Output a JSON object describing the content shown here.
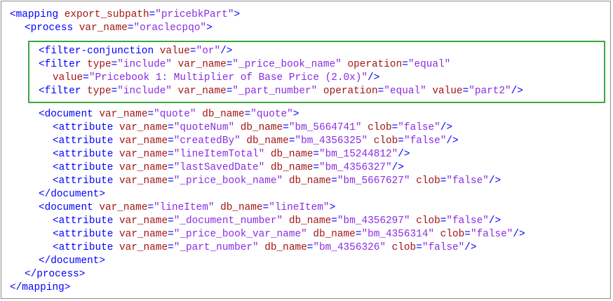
{
  "colors": {
    "tag": "#0000ff",
    "attr": "#a31515",
    "value": "#8a2be2",
    "highlight": "#3da63d"
  },
  "lines": [
    [
      [
        "tag",
        "<mapping"
      ],
      [
        "attr",
        " export_subpath"
      ],
      [
        "tag",
        "="
      ],
      [
        "val",
        "\"pricebkPart\""
      ],
      [
        "tag",
        ">"
      ]
    ],
    [
      [
        "tag",
        "<process"
      ],
      [
        "attr",
        " var_name"
      ],
      [
        "tag",
        "="
      ],
      [
        "val",
        "\"oraclecpqo\""
      ],
      [
        "tag",
        ">"
      ]
    ],
    [
      [
        "tag",
        "<filter-conjunction"
      ],
      [
        "attr",
        " value"
      ],
      [
        "tag",
        "="
      ],
      [
        "val",
        "\"or\""
      ],
      [
        "tag",
        "/>"
      ]
    ],
    [
      [
        "tag",
        "<filter"
      ],
      [
        "attr",
        " type"
      ],
      [
        "tag",
        "="
      ],
      [
        "val",
        "\"include\""
      ],
      [
        "attr",
        " var_name"
      ],
      [
        "tag",
        "="
      ],
      [
        "val",
        "\"_price_book_name\""
      ],
      [
        "attr",
        " operation"
      ],
      [
        "tag",
        "="
      ],
      [
        "val",
        "\"equal\""
      ]
    ],
    [
      [
        "attr",
        "value"
      ],
      [
        "tag",
        "="
      ],
      [
        "val",
        "\"Pricebook 1: Multiplier of Base Price (2.0x)\""
      ],
      [
        "tag",
        "/>"
      ]
    ],
    [
      [
        "tag",
        "<filter"
      ],
      [
        "attr",
        " type"
      ],
      [
        "tag",
        "="
      ],
      [
        "val",
        "\"include\""
      ],
      [
        "attr",
        " var_name"
      ],
      [
        "tag",
        "="
      ],
      [
        "val",
        "\"_part_number\""
      ],
      [
        "attr",
        " operation"
      ],
      [
        "tag",
        "="
      ],
      [
        "val",
        "\"equal\""
      ],
      [
        "attr",
        " value"
      ],
      [
        "tag",
        "="
      ],
      [
        "val",
        "\"part2\""
      ],
      [
        "tag",
        "/>"
      ]
    ],
    [
      [
        "tag",
        "<document"
      ],
      [
        "attr",
        " var_name"
      ],
      [
        "tag",
        "="
      ],
      [
        "val",
        "\"quote\""
      ],
      [
        "attr",
        " db_name"
      ],
      [
        "tag",
        "="
      ],
      [
        "val",
        "\"quote\""
      ],
      [
        "tag",
        ">"
      ]
    ],
    [
      [
        "tag",
        "<attribute"
      ],
      [
        "attr",
        " var_name"
      ],
      [
        "tag",
        "="
      ],
      [
        "val",
        "\"quoteNum\""
      ],
      [
        "attr",
        " db_name"
      ],
      [
        "tag",
        "="
      ],
      [
        "val",
        "\"bm_5664741\""
      ],
      [
        "attr",
        " clob"
      ],
      [
        "tag",
        "="
      ],
      [
        "val",
        "\"false\""
      ],
      [
        "tag",
        "/>"
      ]
    ],
    [
      [
        "tag",
        "<attribute"
      ],
      [
        "attr",
        " var_name"
      ],
      [
        "tag",
        "="
      ],
      [
        "val",
        "\"createdBy\""
      ],
      [
        "attr",
        " db_name"
      ],
      [
        "tag",
        "="
      ],
      [
        "val",
        "\"bm_4356325\""
      ],
      [
        "attr",
        " clob"
      ],
      [
        "tag",
        "="
      ],
      [
        "val",
        "\"false\""
      ],
      [
        "tag",
        "/>"
      ]
    ],
    [
      [
        "tag",
        "<attribute"
      ],
      [
        "attr",
        " var_name"
      ],
      [
        "tag",
        "="
      ],
      [
        "val",
        "\"lineItemTotal\""
      ],
      [
        "attr",
        " db_name"
      ],
      [
        "tag",
        "="
      ],
      [
        "val",
        "\"bm_15244812\""
      ],
      [
        "tag",
        "/>"
      ]
    ],
    [
      [
        "tag",
        "<attribute"
      ],
      [
        "attr",
        " var_name"
      ],
      [
        "tag",
        "="
      ],
      [
        "val",
        "\"lastSavedDate\""
      ],
      [
        "attr",
        " db_name"
      ],
      [
        "tag",
        "="
      ],
      [
        "val",
        "\"bm_4356327\""
      ],
      [
        "tag",
        "/>"
      ]
    ],
    [
      [
        "tag",
        "<attribute"
      ],
      [
        "attr",
        " var_name"
      ],
      [
        "tag",
        "="
      ],
      [
        "val",
        "\"_price_book_name\""
      ],
      [
        "attr",
        " db_name"
      ],
      [
        "tag",
        "="
      ],
      [
        "val",
        "\"bm_5667627\""
      ],
      [
        "attr",
        " clob"
      ],
      [
        "tag",
        "="
      ],
      [
        "val",
        "\"false\""
      ],
      [
        "tag",
        "/>"
      ]
    ],
    [
      [
        "tag",
        "</document>"
      ]
    ],
    [
      [
        "tag",
        "<document"
      ],
      [
        "attr",
        " var_name"
      ],
      [
        "tag",
        "="
      ],
      [
        "val",
        "\"lineItem\""
      ],
      [
        "attr",
        " db_name"
      ],
      [
        "tag",
        "="
      ],
      [
        "val",
        "\"lineItem\""
      ],
      [
        "tag",
        ">"
      ]
    ],
    [
      [
        "tag",
        "<attribute"
      ],
      [
        "attr",
        " var_name"
      ],
      [
        "tag",
        "="
      ],
      [
        "val",
        "\"_document_number\""
      ],
      [
        "attr",
        " db_name"
      ],
      [
        "tag",
        "="
      ],
      [
        "val",
        "\"bm_4356297\""
      ],
      [
        "attr",
        " clob"
      ],
      [
        "tag",
        "="
      ],
      [
        "val",
        "\"false\""
      ],
      [
        "tag",
        "/>"
      ]
    ],
    [
      [
        "tag",
        "<attribute"
      ],
      [
        "attr",
        " var_name"
      ],
      [
        "tag",
        "="
      ],
      [
        "val",
        "\"_price_book_var_name\""
      ],
      [
        "attr",
        " db_name"
      ],
      [
        "tag",
        "="
      ],
      [
        "val",
        "\"bm_4356314\""
      ],
      [
        "attr",
        " clob"
      ],
      [
        "tag",
        "="
      ],
      [
        "val",
        "\"false\""
      ],
      [
        "tag",
        "/>"
      ]
    ],
    [
      [
        "tag",
        "<attribute"
      ],
      [
        "attr",
        " var_name"
      ],
      [
        "tag",
        "="
      ],
      [
        "val",
        "\"_part_number\""
      ],
      [
        "attr",
        " db_name"
      ],
      [
        "tag",
        "="
      ],
      [
        "val",
        "\"bm_4356326\""
      ],
      [
        "attr",
        " clob"
      ],
      [
        "tag",
        "="
      ],
      [
        "val",
        "\"false\""
      ],
      [
        "tag",
        "/>"
      ]
    ],
    [
      [
        "tag",
        "</document>"
      ]
    ],
    [
      [
        "tag",
        "</process>"
      ]
    ],
    [
      [
        "tag",
        "</mapping>"
      ]
    ]
  ]
}
